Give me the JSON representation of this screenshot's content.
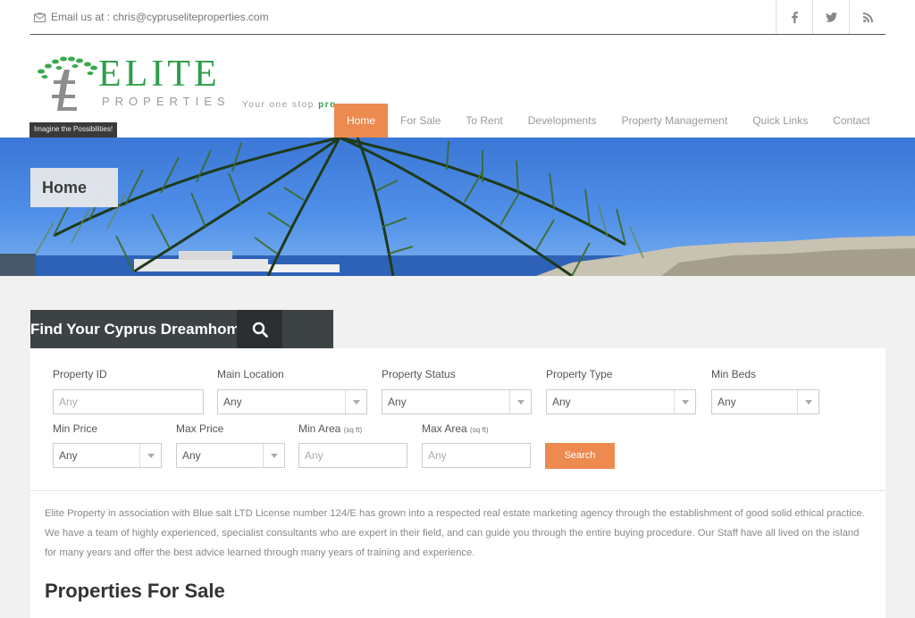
{
  "topbar": {
    "email_text": "Email us at : chris@cypruseliteproperties.com",
    "social": [
      {
        "icon": "facebook-icon",
        "glyph": "f"
      },
      {
        "icon": "twitter-icon",
        "glyph": "t"
      },
      {
        "icon": "rss-icon",
        "glyph": "rss"
      }
    ]
  },
  "brand": {
    "logo_main": "ELITE",
    "logo_sub": "PROPERTIES",
    "tagline_pre": "Your one stop ",
    "tagline_highlight": "pro",
    "tagline_post": "p",
    "imagine": "Imagine the Possibilities!",
    "colors": {
      "green": "#2e9e4a",
      "gray": "#9a9a9a"
    }
  },
  "nav": {
    "items": [
      {
        "label": "Home",
        "active": true
      },
      {
        "label": "For Sale"
      },
      {
        "label": "To Rent"
      },
      {
        "label": "Developments"
      },
      {
        "label": "Property Management"
      },
      {
        "label": "Quick Links"
      },
      {
        "label": "Contact"
      }
    ],
    "accent": "#ed8a4f"
  },
  "hero": {
    "title": "Home"
  },
  "search": {
    "heading": "Find Your Cyprus Dreamhome",
    "fields": {
      "property_id": {
        "label": "Property ID",
        "placeholder": "Any"
      },
      "main_location": {
        "label": "Main Location",
        "value": "Any"
      },
      "property_status": {
        "label": "Property Status",
        "value": "Any"
      },
      "property_type": {
        "label": "Property Type",
        "value": "Any"
      },
      "min_beds": {
        "label": "Min Beds",
        "value": "Any"
      },
      "min_price": {
        "label": "Min Price",
        "value": "Any"
      },
      "max_price": {
        "label": "Max Price",
        "value": "Any"
      },
      "min_area": {
        "label": "Min Area",
        "unit": "(sq ft)",
        "placeholder": "Any"
      },
      "max_area": {
        "label": "Max Area",
        "unit": "(sq ft)",
        "placeholder": "Any"
      }
    },
    "button": "Search"
  },
  "content": {
    "intro": "Elite Property in association with Blue salt LTD License number 124/E has grown into a respected real estate marketing agency through the establishment of good solid ethical practice. We have a team of highly experienced, specialist consultants who are expert in their field, and can guide you through the entire buying procedure. Our Staff have all lived on the island for many years and offer the best advice learned through many years of training and experience.",
    "heading": "Properties For Sale"
  }
}
